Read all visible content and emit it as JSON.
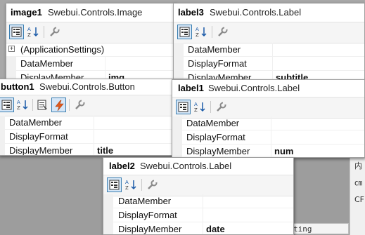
{
  "panels": {
    "image1": {
      "name": "image1",
      "type": "Swebui.Controls.Image",
      "rows": [
        {
          "label": "(ApplicationSettings)",
          "value": ""
        },
        {
          "label": "DataMember",
          "value": ""
        },
        {
          "label": "DisplayMember",
          "value": "img"
        }
      ]
    },
    "label3": {
      "name": "label3",
      "type": "Swebui.Controls.Label",
      "rows": [
        {
          "label": "DataMember",
          "value": ""
        },
        {
          "label": "DisplayFormat",
          "value": ""
        },
        {
          "label": "DisplayMember",
          "value": "subtitle"
        }
      ]
    },
    "button1": {
      "name": "button1",
      "type": "Swebui.Controls.Button",
      "rows": [
        {
          "label": "DataMember",
          "value": ""
        },
        {
          "label": "DisplayFormat",
          "value": ""
        },
        {
          "label": "DisplayMember",
          "value": "title"
        }
      ]
    },
    "label1": {
      "name": "label1",
      "type": "Swebui.Controls.Label",
      "rows": [
        {
          "label": "DataMember",
          "value": ""
        },
        {
          "label": "DisplayFormat",
          "value": ""
        },
        {
          "label": "DisplayMember",
          "value": "num"
        }
      ]
    },
    "label2": {
      "name": "label2",
      "type": "Swebui.Controls.Label",
      "rows": [
        {
          "label": "DataMember",
          "value": ""
        },
        {
          "label": "DisplayFormat",
          "value": ""
        },
        {
          "label": "DisplayMember",
          "value": "date"
        }
      ]
    }
  },
  "toolbar": {
    "icons": [
      "categorized-icon",
      "alphabetical-icon",
      "properties-icon",
      "events-icon",
      "property-pages-icon"
    ]
  },
  "background": {
    "right_strip": [
      "内",
      "㎝",
      "CF"
    ],
    "code_fragment": "ting"
  },
  "colors": {
    "active_button_border": "#3c7fb1",
    "active_button_fill": "#d5e6f7",
    "events_icon": "#e05a1c"
  }
}
